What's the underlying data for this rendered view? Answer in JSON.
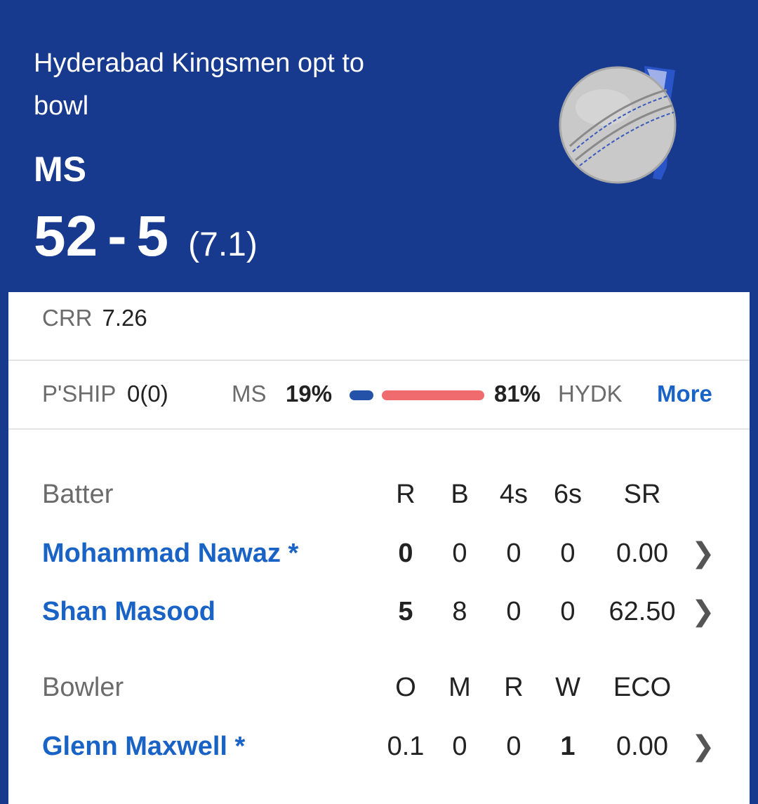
{
  "header": {
    "status_line1": "Hyderabad Kingsmen opt to",
    "status_line2": "bowl",
    "team": "MS",
    "runs": "52",
    "dash": "-",
    "wickets": "5",
    "overs": "(7.1)"
  },
  "crr": {
    "label": "CRR",
    "value": "7.26"
  },
  "partnership": {
    "label": "P'SHIP",
    "value": "0(0)",
    "team1": "MS",
    "team1_pct": "19%",
    "team1_share": 0.19,
    "team2_pct": "81%",
    "team2": "HYDK",
    "more": "More"
  },
  "batting": {
    "header": [
      "Batter",
      "R",
      "B",
      "4s",
      "6s",
      "SR"
    ],
    "rows": [
      {
        "name": "Mohammad Nawaz *",
        "R": "0",
        "B": "0",
        "4s": "0",
        "6s": "0",
        "SR": "0.00"
      },
      {
        "name": "Shan Masood",
        "R": "5",
        "B": "8",
        "4s": "0",
        "6s": "0",
        "SR": "62.50"
      }
    ]
  },
  "bowling": {
    "header": [
      "Bowler",
      "O",
      "M",
      "R",
      "W",
      "ECO"
    ],
    "rows": [
      {
        "name": "Glenn Maxwell *",
        "O": "0.1",
        "M": "0",
        "R": "0",
        "W": "1",
        "ECO": "0.00"
      }
    ]
  },
  "icons": {
    "chevron": "chevron-right-icon",
    "ball": "cricket-ball-icon"
  },
  "colors": {
    "header_bg": "#173a8e",
    "link": "#1a63c6",
    "bar_team1": "#2452a8",
    "bar_team2": "#f06b6e"
  }
}
